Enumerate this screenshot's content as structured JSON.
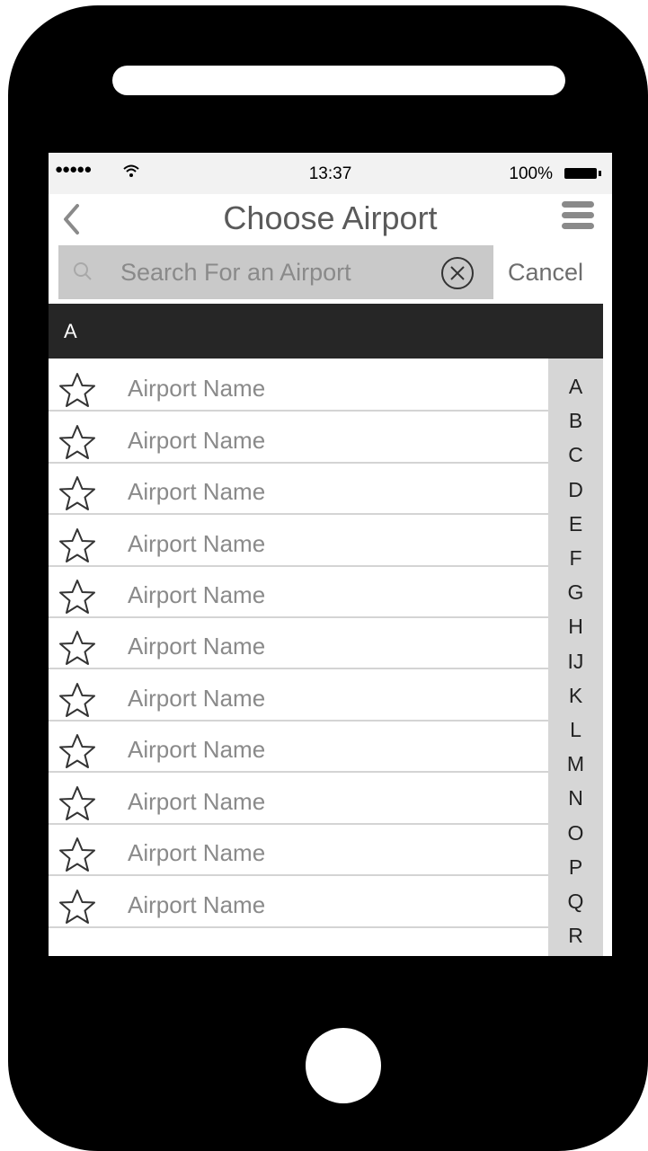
{
  "status_bar": {
    "signal": "●●●●●",
    "time": "13:37",
    "battery": "100%"
  },
  "nav": {
    "title": "Choose Airport"
  },
  "search": {
    "placeholder": "Search For an Airport",
    "value": "",
    "cancel_label": "Cancel"
  },
  "section_header": "A",
  "airports": [
    {
      "name": "Airport Name"
    },
    {
      "name": "Airport Name"
    },
    {
      "name": "Airport Name"
    },
    {
      "name": "Airport Name"
    },
    {
      "name": "Airport Name"
    },
    {
      "name": "Airport Name"
    },
    {
      "name": "Airport Name"
    },
    {
      "name": "Airport Name"
    },
    {
      "name": "Airport Name"
    },
    {
      "name": "Airport Name"
    },
    {
      "name": "Airport Name"
    }
  ],
  "index_letters": [
    "A",
    "B",
    "C",
    "D",
    "E",
    "F",
    "G",
    "H",
    "IJ",
    "K",
    "L",
    "M",
    "N",
    "O",
    "P",
    "Q",
    "R"
  ],
  "icons": {
    "back": "chevron-left-icon",
    "menu": "hamburger-menu-icon",
    "search": "magnifier-icon",
    "clear": "clear-x-circle-icon",
    "favorite": "star-outline-icon",
    "wifi": "wifi-icon",
    "battery": "battery-icon"
  },
  "colors": {
    "section_header_bg": "#262626",
    "search_bg": "#c9c9c9",
    "index_bg": "#d6d6d6",
    "text_gray": "#8a8a8a"
  }
}
